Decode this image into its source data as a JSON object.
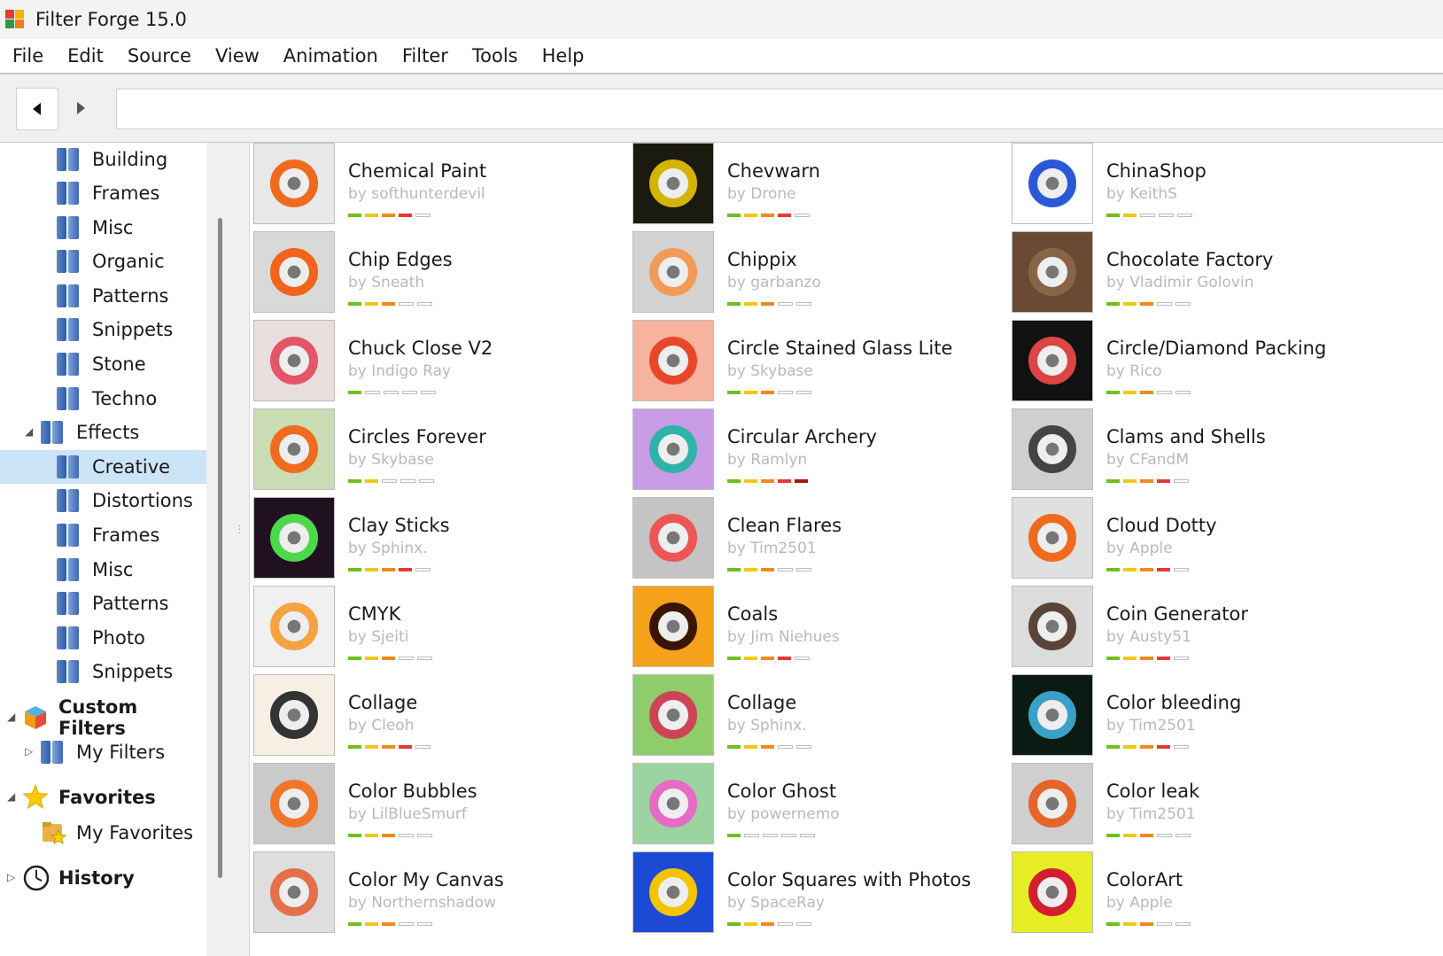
{
  "window": {
    "title": "Filter Forge 15.0"
  },
  "menu": [
    "File",
    "Edit",
    "Source",
    "View",
    "Animation",
    "Filter",
    "Tools",
    "Help"
  ],
  "toolbar": {
    "address": ""
  },
  "colors": {
    "green": "#6fbf1e",
    "yellow": "#f2c811",
    "orange": "#f08a1c",
    "red": "#e53935",
    "darkred": "#a51515"
  },
  "sidebar": {
    "items": [
      {
        "label": "Building",
        "icon": "folder-icon"
      },
      {
        "label": "Frames",
        "icon": "folder-icon"
      },
      {
        "label": "Misc",
        "icon": "folder-icon"
      },
      {
        "label": "Organic",
        "icon": "folder-icon"
      },
      {
        "label": "Patterns",
        "icon": "folder-icon"
      },
      {
        "label": "Snippets",
        "icon": "folder-icon"
      },
      {
        "label": "Stone",
        "icon": "folder-icon"
      },
      {
        "label": "Techno",
        "icon": "folder-icon"
      },
      {
        "label": "Effects",
        "icon": "folder-icon"
      },
      {
        "label": "Creative",
        "icon": "folder-icon",
        "selected": true
      },
      {
        "label": "Distortions",
        "icon": "folder-icon"
      },
      {
        "label": "Frames",
        "icon": "folder-icon"
      },
      {
        "label": "Misc",
        "icon": "folder-icon"
      },
      {
        "label": "Patterns",
        "icon": "folder-icon"
      },
      {
        "label": "Photo",
        "icon": "folder-icon"
      },
      {
        "label": "Snippets",
        "icon": "folder-icon"
      },
      {
        "label": "Custom Filters",
        "icon": "cube-icon"
      },
      {
        "label": "My Filters",
        "icon": "folder-icon"
      },
      {
        "label": "Favorites",
        "icon": "star-icon"
      },
      {
        "label": "My Favorites",
        "icon": "folder-star-icon"
      },
      {
        "label": "History",
        "icon": "clock-icon"
      }
    ]
  },
  "filters": [
    {
      "name": "Chemical Paint",
      "author": "by softhunterdevil",
      "rating": [
        "green",
        "yellow",
        "orange",
        "red",
        "off"
      ]
    },
    {
      "name": "Chevwarn",
      "author": "by Drone",
      "rating": [
        "green",
        "yellow",
        "orange",
        "red",
        "off"
      ]
    },
    {
      "name": "ChinaShop",
      "author": "by KeithS",
      "rating": [
        "green",
        "yellow",
        "off",
        "off",
        "off"
      ]
    },
    {
      "name": "Chip Edges",
      "author": "by Sneath",
      "rating": [
        "green",
        "yellow",
        "orange",
        "off",
        "off"
      ]
    },
    {
      "name": "Chippix",
      "author": "by garbanzo",
      "rating": [
        "green",
        "yellow",
        "orange",
        "off",
        "off"
      ]
    },
    {
      "name": "Chocolate Factory",
      "author": "by Vladimir Golovin",
      "rating": [
        "green",
        "yellow",
        "orange",
        "off",
        "off"
      ]
    },
    {
      "name": "Chuck Close V2",
      "author": "by Indigo Ray",
      "rating": [
        "green",
        "off",
        "off",
        "off",
        "off"
      ]
    },
    {
      "name": "Circle Stained Glass Lite",
      "author": "by Skybase",
      "rating": [
        "green",
        "yellow",
        "orange",
        "off",
        "off"
      ]
    },
    {
      "name": "Circle/Diamond Packing",
      "author": "by Rico",
      "rating": [
        "green",
        "yellow",
        "orange",
        "off",
        "off"
      ]
    },
    {
      "name": "Circles Forever",
      "author": "by Skybase",
      "rating": [
        "green",
        "yellow",
        "off",
        "off",
        "off"
      ]
    },
    {
      "name": "Circular Archery",
      "author": "by Ramlyn",
      "rating": [
        "green",
        "yellow",
        "orange",
        "red",
        "darkred"
      ]
    },
    {
      "name": "Clams and Shells",
      "author": "by CFandM",
      "rating": [
        "green",
        "yellow",
        "orange",
        "red",
        "off"
      ]
    },
    {
      "name": "Clay Sticks",
      "author": "by Sphinx.",
      "rating": [
        "green",
        "yellow",
        "orange",
        "red",
        "off"
      ]
    },
    {
      "name": "Clean Flares",
      "author": "by Tim2501",
      "rating": [
        "green",
        "yellow",
        "orange",
        "off",
        "off"
      ]
    },
    {
      "name": "Cloud Dotty",
      "author": "by Apple",
      "rating": [
        "green",
        "yellow",
        "orange",
        "red",
        "off"
      ]
    },
    {
      "name": "CMYK",
      "author": "by Sjeiti",
      "rating": [
        "green",
        "yellow",
        "orange",
        "off",
        "off"
      ]
    },
    {
      "name": "Coals",
      "author": "by Jim Niehues",
      "rating": [
        "green",
        "yellow",
        "orange",
        "red",
        "off"
      ]
    },
    {
      "name": "Coin Generator",
      "author": "by Austy51",
      "rating": [
        "green",
        "yellow",
        "orange",
        "red",
        "off"
      ]
    },
    {
      "name": "Collage",
      "author": "by Cleoh",
      "rating": [
        "green",
        "yellow",
        "orange",
        "red",
        "off"
      ]
    },
    {
      "name": "Collage",
      "author": "by Sphinx.",
      "rating": [
        "green",
        "yellow",
        "orange",
        "off",
        "off"
      ]
    },
    {
      "name": "Color bleeding",
      "author": "by Tim2501",
      "rating": [
        "green",
        "yellow",
        "orange",
        "red",
        "off"
      ]
    },
    {
      "name": "Color Bubbles",
      "author": "by LilBlueSmurf",
      "rating": [
        "green",
        "yellow",
        "orange",
        "off",
        "off"
      ]
    },
    {
      "name": "Color Ghost",
      "author": "by powernemo",
      "rating": [
        "green",
        "off",
        "off",
        "off",
        "off"
      ]
    },
    {
      "name": "Color leak",
      "author": "by Tim2501",
      "rating": [
        "green",
        "yellow",
        "orange",
        "off",
        "off"
      ]
    },
    {
      "name": "Color My Canvas",
      "author": "by Northernshadow",
      "rating": [
        "green",
        "yellow",
        "orange",
        "off",
        "off"
      ]
    },
    {
      "name": "Color Squares with Photos",
      "author": "by SpaceRay",
      "rating": [
        "green",
        "yellow",
        "orange",
        "off",
        "off"
      ]
    },
    {
      "name": "ColorArt",
      "author": "by Apple",
      "rating": [
        "green",
        "yellow",
        "orange",
        "off",
        "off"
      ]
    }
  ]
}
